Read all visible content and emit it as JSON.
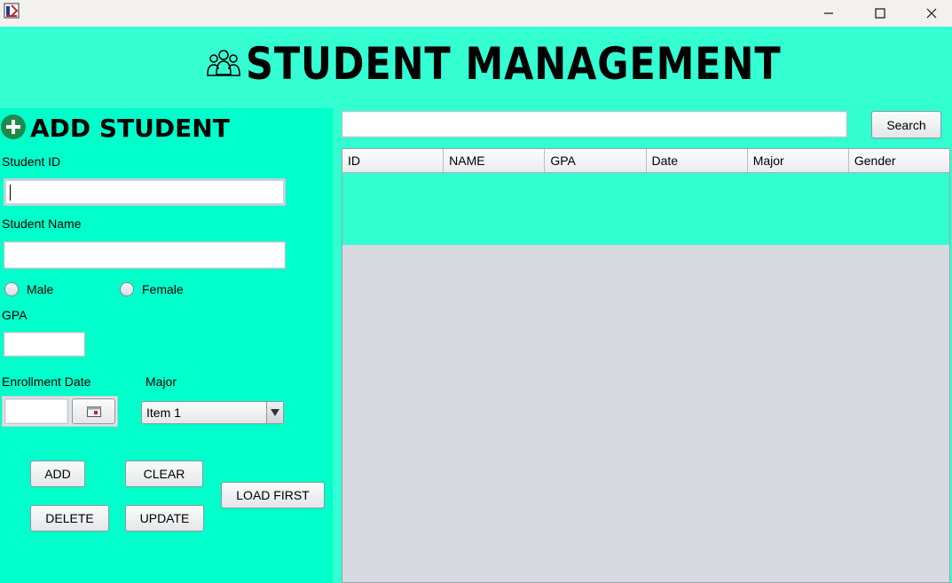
{
  "window": {
    "minimize_glyph": "—",
    "maximize_glyph": "☐",
    "close_glyph": "✕"
  },
  "header": {
    "title": "STUDENT MANAGEMENT"
  },
  "form": {
    "section_title": "ADD STUDENT",
    "student_id_label": "Student ID",
    "student_id_value": "",
    "student_name_label": "Student Name",
    "student_name_value": "",
    "gender_options": [
      "Male",
      "Female"
    ],
    "gpa_label": "GPA",
    "gpa_value": "",
    "enrollment_date_label": "Enrollment Date",
    "enrollment_date_value": "",
    "major_label": "Major",
    "major_selected": "Item 1",
    "buttons": {
      "add": "ADD",
      "clear": "CLEAR",
      "delete": "DELETE",
      "update": "UPDATE",
      "load_first": "LOAD FIRST"
    }
  },
  "search": {
    "value": "",
    "button": "Search"
  },
  "table": {
    "columns": [
      "ID",
      "NAME",
      "GPA",
      "Date",
      "Major",
      "Gender"
    ],
    "rows": []
  },
  "colors": {
    "background": "#32ffd1",
    "left_panel": "#00ffcb",
    "table_empty": "#d6d9df"
  }
}
